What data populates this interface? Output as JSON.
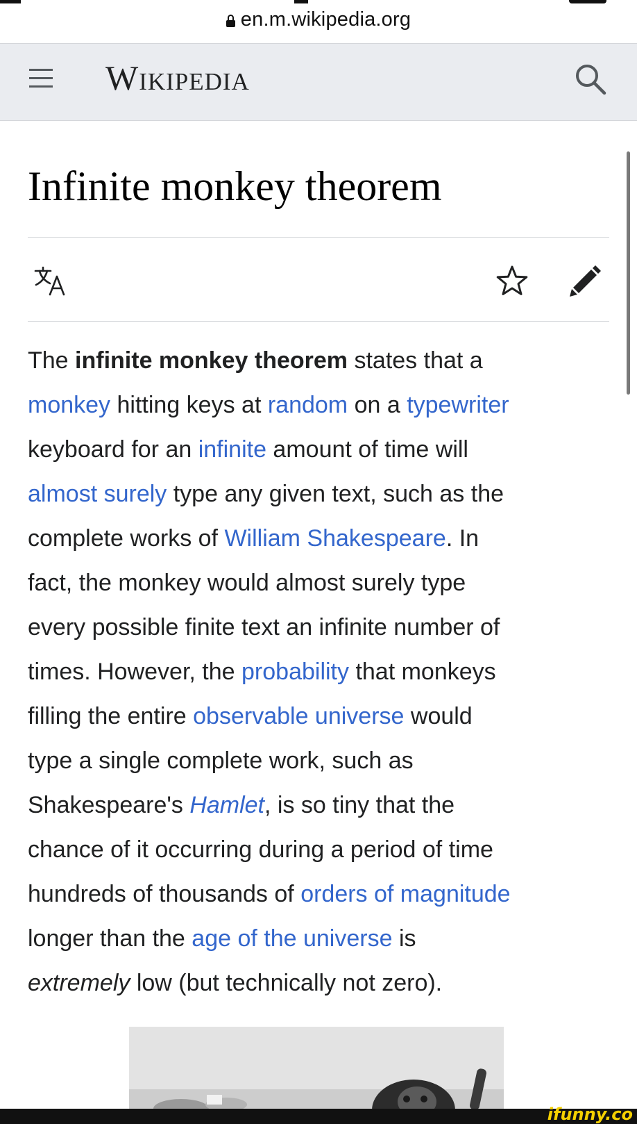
{
  "browser": {
    "url": "en.m.wikipedia.org"
  },
  "header": {
    "wordmark": "Wikipedia"
  },
  "article": {
    "title": "Infinite monkey theorem",
    "lines": [
      [
        {
          "t": "The "
        },
        {
          "t": "infinite monkey theorem",
          "b": true
        },
        {
          "t": " states that a"
        }
      ],
      [
        {
          "t": "monkey",
          "link": true
        },
        {
          "t": " hitting keys at "
        },
        {
          "t": "random",
          "link": true
        },
        {
          "t": " on a "
        },
        {
          "t": "typewriter",
          "link": true
        }
      ],
      [
        {
          "t": "keyboard for an "
        },
        {
          "t": "infinite",
          "link": true
        },
        {
          "t": " amount of time will"
        }
      ],
      [
        {
          "t": "almost surely",
          "link": true
        },
        {
          "t": " type any given text, such as the"
        }
      ],
      [
        {
          "t": "complete works of "
        },
        {
          "t": "William Shakespeare",
          "link": true
        },
        {
          "t": ". In"
        }
      ],
      [
        {
          "t": "fact, the monkey would almost surely type"
        }
      ],
      [
        {
          "t": "every possible finite text an infinite number of"
        }
      ],
      [
        {
          "t": "times. However, the "
        },
        {
          "t": "probability",
          "link": true
        },
        {
          "t": " that monkeys"
        }
      ],
      [
        {
          "t": "filling the entire "
        },
        {
          "t": "observable universe",
          "link": true
        },
        {
          "t": " would"
        }
      ],
      [
        {
          "t": "type a single complete work, such as"
        }
      ],
      [
        {
          "t": "Shakespeare's "
        },
        {
          "t": "Hamlet",
          "link": true,
          "i": true
        },
        {
          "t": ", is so tiny that the"
        }
      ],
      [
        {
          "t": "chance of it occurring during a period of time"
        }
      ],
      [
        {
          "t": "hundreds of thousands of "
        },
        {
          "t": "orders of magnitude",
          "link": true
        }
      ],
      [
        {
          "t": "longer than the "
        },
        {
          "t": "age of the universe",
          "link": true
        },
        {
          "t": " is"
        }
      ],
      [
        {
          "t": "extremely",
          "i": true
        },
        {
          "t": " low (but technically not zero)."
        }
      ]
    ]
  },
  "watermark": "ifunny.co",
  "colors": {
    "link": "#3366cc",
    "header_bg": "#eaecf0",
    "text": "#202122"
  },
  "icons": [
    "lock-icon",
    "menu-icon",
    "search-icon",
    "language-icon",
    "star-icon",
    "edit-icon"
  ]
}
